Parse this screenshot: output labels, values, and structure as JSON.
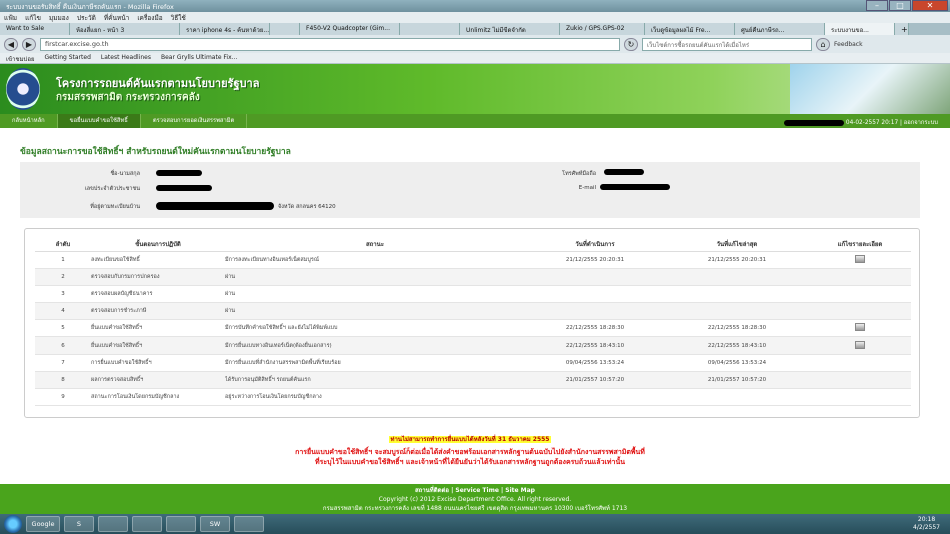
{
  "browser": {
    "window_title": "ระบบงานขอรับสิทธิ์ คืนเงินภาษีรถคันแรก - Mozilla Firefox",
    "menu": [
      "แฟ้ม",
      "แก้ไข",
      "มุมมอง",
      "ประวัติ",
      "ที่คั่นหน้า",
      "เครื่องมือ",
      "วิธีใช้"
    ],
    "tabs": [
      "Want to Sale",
      "ห้องสี่แยก - หน้า 3",
      "ราคา iphone 4s - ค้นหาด้วย...",
      "",
      "F450-V2 Quadcopter (Gim...",
      "",
      "Unlimitz ไม่มีขีดจำกัด",
      "Zukio / GPS.GPS-02",
      "เว็บดูข้อมูลผลไม้ Fre...",
      "ศูนย์คืนภาษีรถ...",
      "ระบบงานขอ..."
    ],
    "url": "firstcar.excise.go.th",
    "search_placeholder": "เว็บไซต์การซื้อรถยนต์คันแรกได้เมื่อไหร่",
    "nav_right": "Feedback",
    "bookmarks": [
      "เข้าชมบ่อย",
      "Getting Started",
      "Latest Headlines",
      "Bear Grylls Ultimate Fix..."
    ]
  },
  "site": {
    "title_line1": "โครงการรถยนต์คันแรกตามนโยบายรัฐบาล",
    "title_line2": "กรมสรรพสามิต กระทรวงการคลัง",
    "menu": [
      "กลับหน้าหลัก",
      "ขอยื่นแบบคำขอใช้สิทธิ์",
      "ตรวจสอบการยอดเงินสรรพสามิต"
    ],
    "login_info": "04-02-2557 20:17 | ออกจากระบบ"
  },
  "main": {
    "section_title": "ข้อมูลสถานะการขอใช้สิทธิ์ฯ สำหรับรถยนต์ใหม่คันแรกตามนโยบายรัฐบาล",
    "labels": {
      "name": "ชื่อ-นามสกุล",
      "id_card": "เลขประจำตัวประชาชน",
      "address": "ที่อยู่ตามทะเบียนบ้าน",
      "phone": "โทรศัพท์มือถือ",
      "email": "E-mail"
    },
    "address_tail": "จังหวัด สกลนคร 64120",
    "table_headers": [
      "ลำดับ",
      "ขั้นตอนการปฏิบัติ",
      "สถานะ",
      "วันที่ดำเนินการ",
      "วันที่แก้ไขล่าสุด",
      "แก้ไขรายละเอียด"
    ],
    "rows": [
      {
        "no": "1",
        "step": "ลงทะเบียนขอใช้สิทธิ์",
        "status": "มีการลงทะเบียนทางอินเทอร์เน็ตสมบูรณ์",
        "date": "21/12/2555 20:20:31",
        "updated": "21/12/2555 20:20:31",
        "icon": true
      },
      {
        "no": "2",
        "step": "ตรวจสอบกับกรมการปกครอง",
        "status": "ผ่าน",
        "date": "",
        "updated": "",
        "icon": false
      },
      {
        "no": "3",
        "step": "ตรวจสอบผลบัญชีธนาคาร",
        "status": "ผ่าน",
        "date": "",
        "updated": "",
        "icon": false
      },
      {
        "no": "4",
        "step": "ตรวจสอบการชำระภาษี",
        "status": "ผ่าน",
        "date": "",
        "updated": "",
        "icon": false
      },
      {
        "no": "5",
        "step": "ยื่นแบบคำขอใช้สิทธิ์ฯ",
        "status": "มีการบันทึกคำขอใช้สิทธิ์ฯ และยังไม่ได้พิมพ์แบบ",
        "date": "22/12/2555 18:28:30",
        "updated": "22/12/2555 18:28:30",
        "icon": true
      },
      {
        "no": "6",
        "step": "ยื่นแบบคำขอใช้สิทธิ์ฯ",
        "status": "มีการยื่นแบบทางอินเทอร์เน็ต(ต้องยื่นเอกสาร)",
        "date": "22/12/2555 18:43:10",
        "updated": "22/12/2555 18:43:10",
        "icon": true
      },
      {
        "no": "7",
        "step": "การยื่นแบบคำขอใช้สิทธิ์ฯ",
        "status": "มีการยื่นแบบที่สำนักงานสรรพสามิตพื้นที่เรียบร้อย",
        "date": "09/04/2556 13:53:24",
        "updated": "09/04/2556 13:53:24",
        "icon": false
      },
      {
        "no": "8",
        "step": "ผลการตรวจสอบสิทธิ์ฯ",
        "status": "ได้รับการอนุมัติสิทธิ์ฯ รถยนต์คันแรก",
        "date": "21/01/2557 10:57:20",
        "updated": "21/01/2557 10:57:20",
        "icon": false
      },
      {
        "no": "9",
        "step": "สถานะการโอนเงินโดยกรมบัญชีกลาง",
        "status": "อยู่ระหว่างการโอนเงินโดยกรมบัญชีกลาง",
        "date": "",
        "updated": "",
        "icon": false
      }
    ],
    "notice_highlight": "ท่านไม่สามารถทำการยื่นแบบได้หลังวันที่ 31 ธันวาคม 2555",
    "notice_line1": "การยื่นแบบคำขอใช้สิทธิ์ฯ จะสมบูรณ์ก็ต่อเมื่อได้ส่งคำขอพร้อมเอกสารหลักฐานต้นฉบับไปยังสำนักงานสรรพสามิตพื้นที่",
    "notice_line2": "ที่ระบุไว้ในแบบคำขอใช้สิทธิ์ฯ และเจ้าหน้าที่ได้ยืนยันว่าได้รับเอกสารหลักฐานถูกต้องครบถ้วนแล้วเท่านั้น"
  },
  "footer": {
    "links": "สถานที่ติดต่อ | Service Time | Site Map",
    "copyright": "Copyright (c) 2012 Excise Department Office. All right reserved.",
    "address": "กรมสรรพสามิต กระทรวงการคลัง เลขที่ 1488 ถนนนครไชยศรี เขตดุสิต กรุงเทพมหานคร 10300 เบอร์โทรศัพท์ 1713"
  },
  "taskbar": {
    "apps": [
      "Google",
      "S",
      "",
      "",
      "",
      "SW",
      ""
    ],
    "time": "20:18",
    "date": "4/2/2557"
  }
}
